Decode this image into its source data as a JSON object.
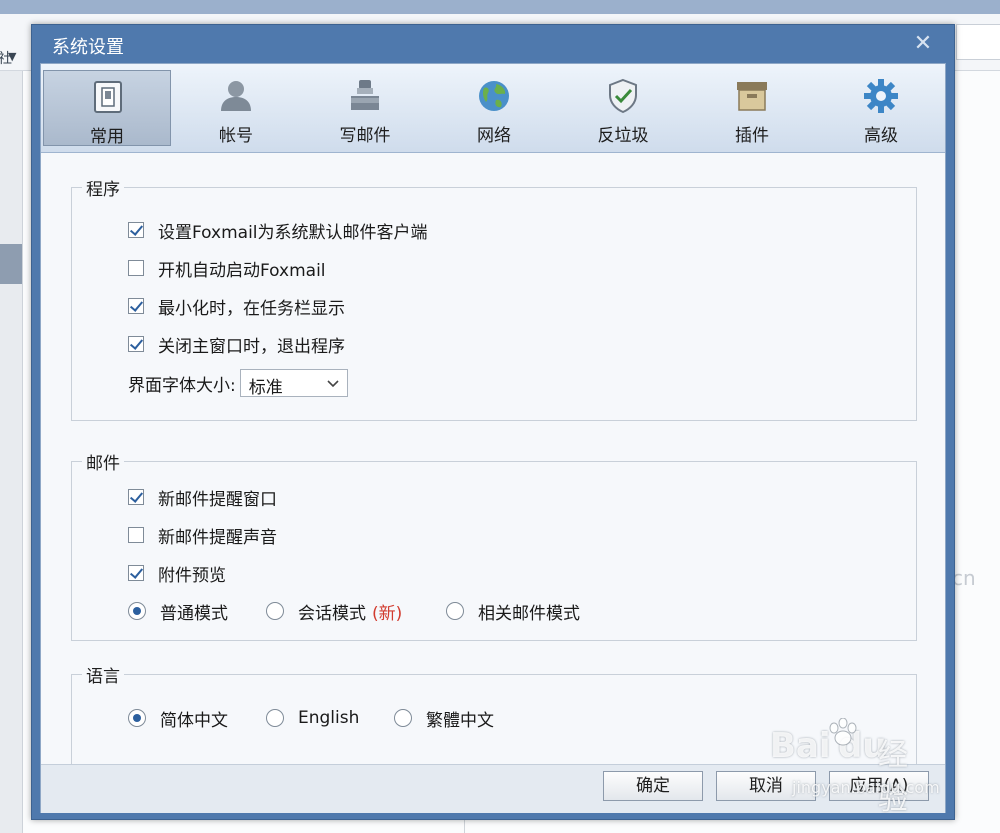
{
  "background": {
    "toolbar_label": "社",
    "watermark_suffix": "cn"
  },
  "dialog": {
    "title": "系统设置",
    "tabs": [
      {
        "label": "常用",
        "icon": "switch-icon",
        "active": true
      },
      {
        "label": "帐号",
        "icon": "user-icon",
        "active": false
      },
      {
        "label": "写邮件",
        "icon": "inkwell-icon",
        "active": false
      },
      {
        "label": "网络",
        "icon": "globe-icon",
        "active": false
      },
      {
        "label": "反垃圾",
        "icon": "shield-check-icon",
        "active": false
      },
      {
        "label": "插件",
        "icon": "box-icon",
        "active": false
      },
      {
        "label": "高级",
        "icon": "gear-icon",
        "active": false
      }
    ],
    "program": {
      "title": "程序",
      "options": [
        {
          "label": "设置Foxmail为系统默认邮件客户端",
          "checked": true
        },
        {
          "label": "开机自动启动Foxmail",
          "checked": false
        },
        {
          "label": "最小化时，在任务栏显示",
          "checked": true
        },
        {
          "label": "关闭主窗口时，退出程序",
          "checked": true
        }
      ],
      "font_size_label": "界面字体大小:",
      "font_size_value": "标准"
    },
    "mail": {
      "title": "邮件",
      "options": [
        {
          "label": "新邮件提醒窗口",
          "checked": true
        },
        {
          "label": "新邮件提醒声音",
          "checked": false
        },
        {
          "label": "附件预览",
          "checked": true
        }
      ],
      "modes": [
        {
          "label": "普通模式",
          "selected": true
        },
        {
          "label": "会话模式",
          "tag": "(新)",
          "selected": false
        },
        {
          "label": "相关邮件模式",
          "selected": false
        }
      ]
    },
    "language": {
      "title": "语言",
      "options": [
        {
          "label": "简体中文",
          "selected": true
        },
        {
          "label": "English",
          "selected": false
        },
        {
          "label": "繁體中文",
          "selected": false
        }
      ]
    },
    "buttons": {
      "ok": "确定",
      "cancel": "取消",
      "apply": "应用(A)"
    },
    "watermark": {
      "brand": "Bai",
      "brand2": "du",
      "suffix": "经验",
      "url": "jingyan.baidu.com"
    }
  },
  "colors": {
    "titlebar": "#4f79ad",
    "accent": "#2c5f9e",
    "new_tag": "#d23c2f"
  }
}
